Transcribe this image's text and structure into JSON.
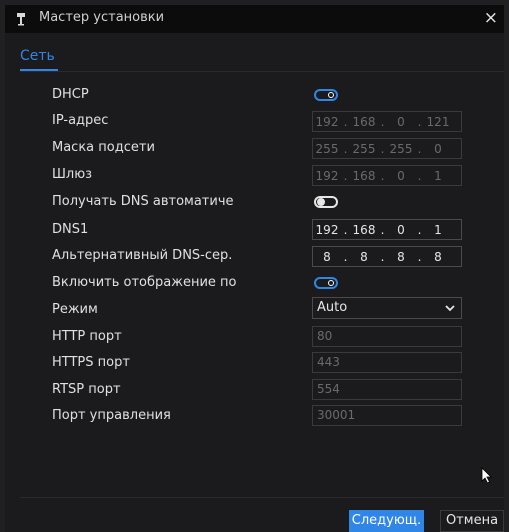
{
  "window": {
    "title": "Мастер установки",
    "close_glyph": "×"
  },
  "tab": {
    "label": "Сеть"
  },
  "rows": {
    "dhcp": {
      "label": "DHCP",
      "state": "on"
    },
    "ip": {
      "label": "IP-адрес",
      "octets": [
        "192",
        "168",
        "0",
        "121"
      ]
    },
    "mask": {
      "label": "Маска подсети",
      "octets": [
        "255",
        "255",
        "255",
        "0"
      ]
    },
    "gateway": {
      "label": "Шлюз",
      "octets": [
        "192",
        "168",
        "0",
        "1"
      ]
    },
    "dns_auto": {
      "label": "Получать DNS автоматиче",
      "state": "off"
    },
    "dns1": {
      "label": "DNS1",
      "octets": [
        "192",
        "168",
        "0",
        "1"
      ]
    },
    "dns_alt": {
      "label": "Альтернативный DNS-сер.",
      "octets": [
        "8",
        "8",
        "8",
        "8"
      ]
    },
    "display": {
      "label": "Включить отображение по",
      "state": "on"
    },
    "mode": {
      "label": "Режим",
      "value": "Auto"
    },
    "http": {
      "label": "HTTP порт",
      "value": "80"
    },
    "https": {
      "label": "HTTPS порт",
      "value": "443"
    },
    "rtsp": {
      "label": "RTSP порт",
      "value": "554"
    },
    "mgmt": {
      "label": "Порт управления",
      "value": "30001"
    }
  },
  "buttons": {
    "next": "Следующ.",
    "cancel": "Отмена"
  },
  "colors": {
    "accent": "#2f86e6",
    "bg": "#1b1b1d",
    "titlebar": "#0c0c0d"
  }
}
